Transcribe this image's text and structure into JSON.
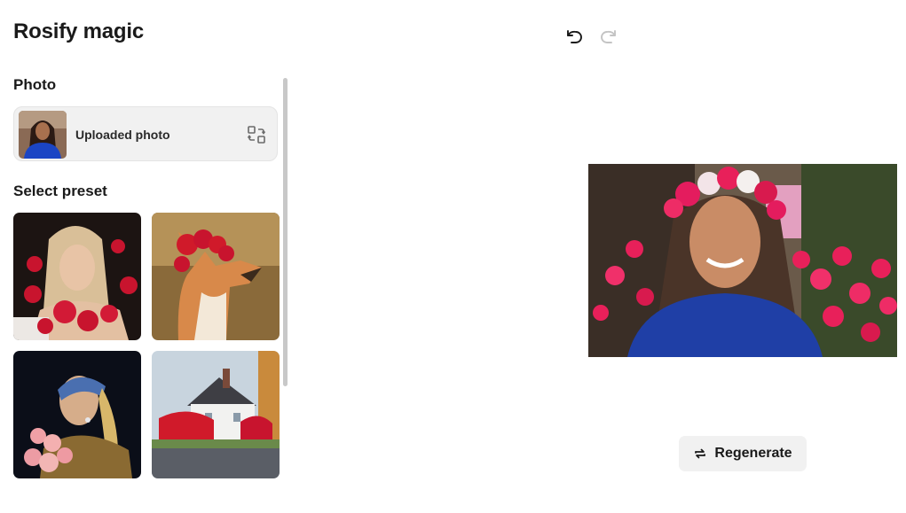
{
  "app": {
    "title": "Rosify magic"
  },
  "photo": {
    "section_label": "Photo",
    "uploaded_label": "Uploaded photo"
  },
  "presets": {
    "section_label": "Select preset"
  },
  "actions": {
    "regenerate_label": "Regenerate"
  },
  "icons": {
    "undo": "undo-icon",
    "redo": "redo-icon",
    "replace": "replace-photo-icon",
    "regenerate": "repeat-icon"
  },
  "colors": {
    "accent_rose": "#d8163a",
    "button_bg": "#f1f1f1",
    "text": "#1a1a1a"
  }
}
